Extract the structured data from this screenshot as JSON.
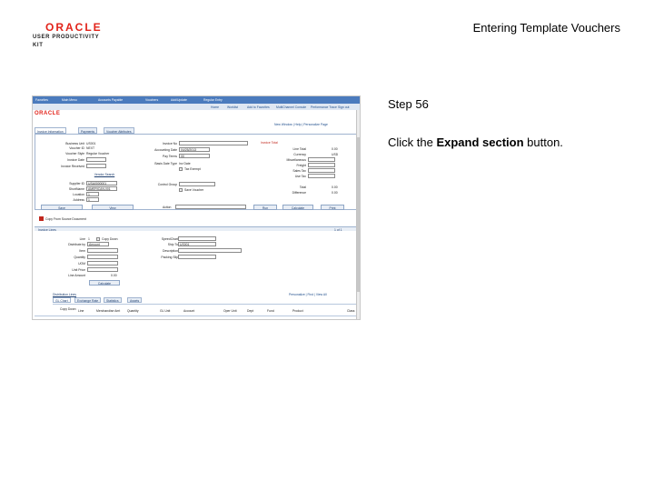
{
  "slide": {
    "logo_line1": "ORACLE",
    "logo_line2": "USER PRODUCTIVITY KIT",
    "title": "Entering Template Vouchers",
    "step_label": "Step 56",
    "instruction_prefix": "Click the ",
    "instruction_bold": "Expand section",
    "instruction_suffix": " button."
  },
  "screenshot": {
    "breadcrumb": [
      "Favorites",
      "Main Menu",
      "Accounts Payable",
      "Vouchers",
      "Add/Update",
      "Regular Entry"
    ],
    "nav_links": [
      "Home",
      "Worklist",
      "Add to Favorites",
      "MultiChannel Console",
      "Performance Trace",
      "Sign out"
    ],
    "logo": "ORACLE",
    "top_links": "New Window | Help | Personalize Page",
    "tabs": [
      "Invoice Information",
      "Payments",
      "Voucher Attributes"
    ],
    "header": {
      "business_unit_label": "Business Unit",
      "business_unit": "US001",
      "voucher_id_label": "Voucher ID",
      "voucher_id": "NEXT",
      "voucher_style_label": "Voucher Style",
      "voucher_style": "Regular Voucher",
      "invoice_date_label": "Invoice Date",
      "invoice_received_label": "Invoice Received",
      "invoice_no_label": "Invoice No",
      "accounting_date_label": "Accounting Date",
      "accounting_date": "04/25/2013",
      "pay_terms_label": "Pay Terms",
      "pay_terms": "00",
      "basis_date_type_label": "Basis Date Type",
      "basis_date_type": "Inv Date",
      "tax_exempt_label": "Tax Exempt",
      "vendor_search_label": "Vendor Search",
      "supplier_label": "Supplier ID",
      "supplier": "USA0000001",
      "short_name_label": "ShortName",
      "short_name": "AMERICAN-001",
      "location_label": "Location",
      "location": "1",
      "address_label": "Address",
      "address": "1",
      "control_group_label": "Control Group",
      "save_voucher_label": "Save Voucher",
      "invoice_total_label": "Invoice Total",
      "line_total_label": "Line Total",
      "line_total": "0.00",
      "currency_label": "Currency",
      "currency": "USD",
      "misc_label": "Miscellaneous",
      "freight_label": "Freight",
      "sales_tax_label": "Sales Tax",
      "use_tax_label": "Use Tax",
      "total_label": "Total",
      "total": "0.00",
      "difference_label": "Difference",
      "difference": "0.00",
      "save_button": "Save",
      "view_button": "View",
      "action_label": "Action",
      "run_button": "Run",
      "calculate_button": "Calculate",
      "print_button": "Print"
    },
    "copy_from": "Copy From Source Document",
    "invoice_lines": {
      "section_title": "Invoice Lines",
      "pager": "1 of 1",
      "line_label": "Line",
      "line": "1",
      "copy_down_label": "Copy Down",
      "distribute_label": "Distribute by",
      "distribute": "Amount",
      "sets_label": "SpeedChart",
      "item_label": "Item",
      "quantity_label": "Quantity",
      "uom_label": "UOM",
      "unit_price_label": "Unit Price",
      "line_amount_label": "Line Amount",
      "line_amount": "0.00",
      "ship_to_label": "Ship To",
      "ship_to": "US001",
      "description_label": "Description",
      "packing_slip_label": "Packing Slip",
      "ship_button": "Calculate"
    },
    "dist_lines": {
      "section_title": "Distribution Lines",
      "links": "Personalize | Find | View All",
      "tabs": [
        "GL Chart",
        "Exchange Rate",
        "Statistics",
        "Assets"
      ],
      "columns": [
        "Copy Down",
        "Line",
        "Merchandise Amt",
        "Quantity",
        "GL Unit",
        "Account",
        "Oper Unit",
        "Dept",
        "Fund",
        "Product",
        "Class"
      ]
    }
  }
}
